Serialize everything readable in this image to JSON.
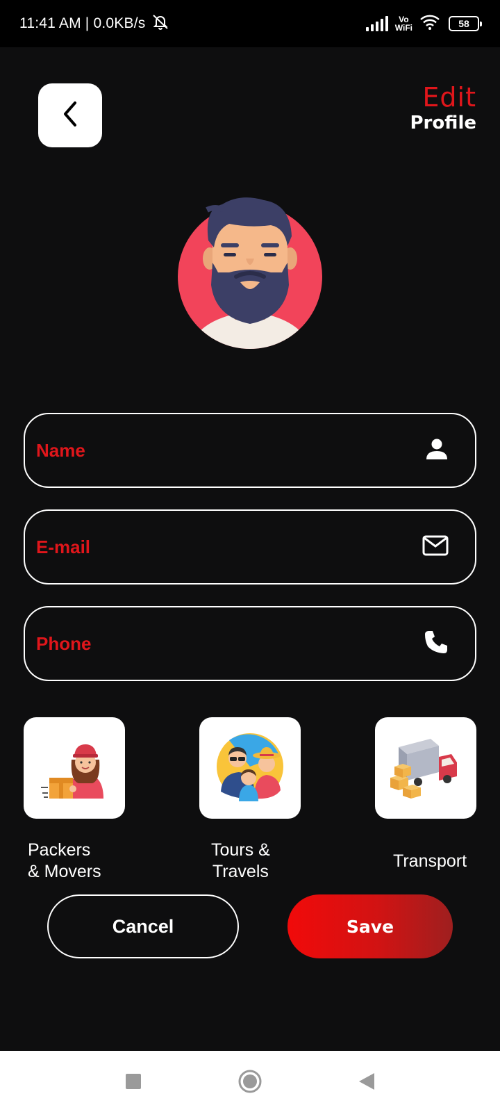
{
  "status_bar": {
    "time_text": "11:41 AM | 0.0KB/s",
    "vo_label": "Vo",
    "wifi_label": "WiFi",
    "battery": "58"
  },
  "header": {
    "title_top": "Edit",
    "title_bottom": "Profile"
  },
  "form": {
    "name_placeholder": "Name",
    "email_placeholder": "E-mail",
    "phone_placeholder": "Phone"
  },
  "categories": [
    {
      "line1": "Packers",
      "line2": "& Movers",
      "icon": "packers-movers-icon"
    },
    {
      "line1": "Tours &",
      "line2": "Travels",
      "icon": "tours-travels-icon"
    },
    {
      "line1": "Transport",
      "icon": "transport-truck-icon"
    }
  ],
  "actions": {
    "cancel_label": "Cancel",
    "save_label": "Save"
  },
  "colors": {
    "accent": "#e0161b",
    "background": "#0e0e0f",
    "avatar_bg": "#f2445a"
  }
}
